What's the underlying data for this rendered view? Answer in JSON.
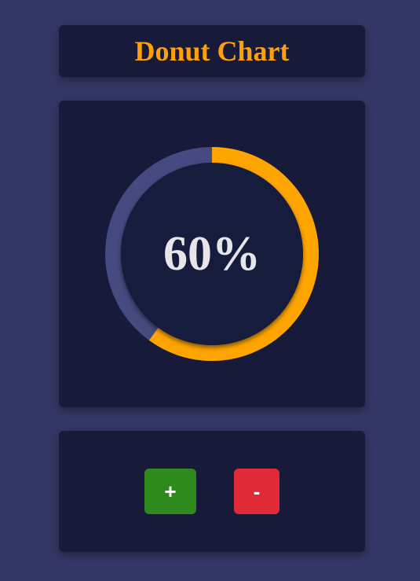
{
  "header": {
    "title": "Donut Chart"
  },
  "donut": {
    "value": 60,
    "label": "60%",
    "progress_color": "#ffa500",
    "track_color": "#454a80",
    "inner_color": "#181a3a"
  },
  "controls": {
    "increase_label": "+",
    "decrease_label": "-",
    "increase_color": "#2e8a1c",
    "decrease_color": "#e02a38"
  },
  "colors": {
    "background": "#343765",
    "card": "#181a3a",
    "accent": "#ff9f0a"
  }
}
